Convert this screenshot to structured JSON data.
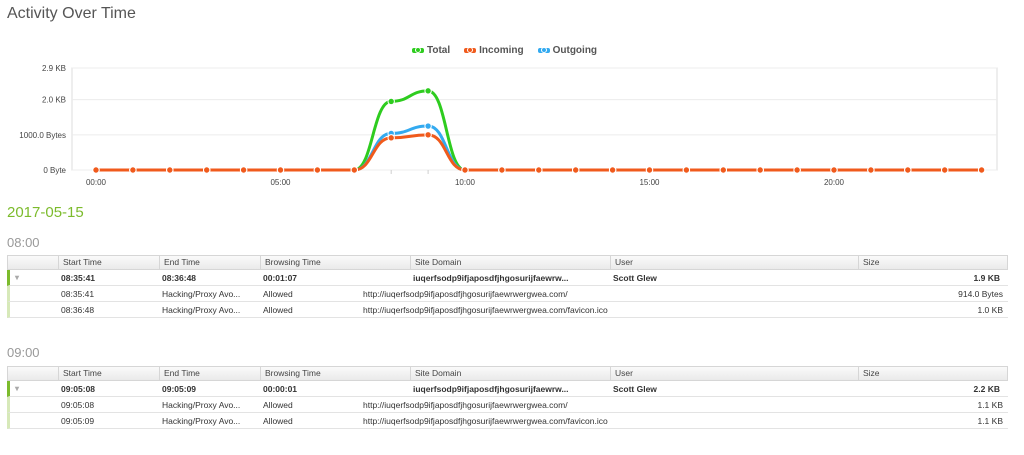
{
  "page": {
    "title": "Activity Over Time"
  },
  "chart_data": {
    "type": "line",
    "title": "",
    "x": [
      0,
      1,
      2,
      3,
      4,
      5,
      6,
      7,
      8,
      9,
      10,
      11,
      12,
      13,
      14,
      15,
      16,
      17,
      18,
      19,
      20,
      21,
      22,
      23,
      24
    ],
    "xticks": [
      "00:00",
      "05:00",
      "10:00",
      "15:00",
      "20:00"
    ],
    "xtick_values": [
      0,
      5,
      10,
      15,
      20
    ],
    "yticks": [
      "0 Byte",
      "1000.0 Bytes",
      "2.0 KB",
      "2.9 KB"
    ],
    "ytick_values": [
      0,
      1000,
      2000,
      2900
    ],
    "ylim": [
      0,
      2900
    ],
    "legend_position": "top-center",
    "grid": true,
    "series": [
      {
        "name": "Total",
        "color": "#2ecc1f",
        "values": [
          0,
          0,
          0,
          0,
          0,
          0,
          0,
          0,
          1950,
          2250,
          0,
          0,
          0,
          0,
          0,
          0,
          0,
          0,
          0,
          0,
          0,
          0,
          0,
          0,
          0
        ]
      },
      {
        "name": "Incoming",
        "color": "#f05a1c",
        "values": [
          0,
          0,
          0,
          0,
          0,
          0,
          0,
          0,
          914,
          1000,
          0,
          0,
          0,
          0,
          0,
          0,
          0,
          0,
          0,
          0,
          0,
          0,
          0,
          0,
          0
        ]
      },
      {
        "name": "Outgoing",
        "color": "#33aaf0",
        "values": [
          0,
          0,
          0,
          0,
          0,
          0,
          0,
          0,
          1040,
          1250,
          0,
          0,
          0,
          0,
          0,
          0,
          0,
          0,
          0,
          0,
          0,
          0,
          0,
          0,
          0
        ]
      }
    ]
  },
  "date_heading": "2017-05-15",
  "columns": [
    "",
    "Start Time",
    "End Time",
    "Browsing Time",
    "Site Domain",
    "User",
    "Size"
  ],
  "groups": [
    {
      "hour": "08:00",
      "main": {
        "caret": "▾",
        "start": "08:35:41",
        "end": "08:36:48",
        "browsing": "00:01:07",
        "domain": "iuqerfsodp9ifjaposdfjhgosurijfaewrw...",
        "user": "Scott Glew",
        "size": "1.9 KB"
      },
      "subs": [
        {
          "time": "08:35:41",
          "category": "Hacking/Proxy Avo...",
          "status": "Allowed",
          "url": "http://iuqerfsodp9ifjaposdfjhgosurijfaewrwergwea.com/",
          "size": "914.0 Bytes"
        },
        {
          "time": "08:36:48",
          "category": "Hacking/Proxy Avo...",
          "status": "Allowed",
          "url": "http://iuqerfsodp9ifjaposdfjhgosurijfaewrwergwea.com/favicon.ico",
          "size": "1.0 KB"
        }
      ]
    },
    {
      "hour": "09:00",
      "main": {
        "caret": "▾",
        "start": "09:05:08",
        "end": "09:05:09",
        "browsing": "00:00:01",
        "domain": "iuqerfsodp9ifjaposdfjhgosurijfaewrw...",
        "user": "Scott Glew",
        "size": "2.2 KB"
      },
      "subs": [
        {
          "time": "09:05:08",
          "category": "Hacking/Proxy Avo...",
          "status": "Allowed",
          "url": "http://iuqerfsodp9ifjaposdfjhgosurijfaewrwergwea.com/",
          "size": "1.1 KB"
        },
        {
          "time": "09:05:09",
          "category": "Hacking/Proxy Avo...",
          "status": "Allowed",
          "url": "http://iuqerfsodp9ifjaposdfjhgosurijfaewrwergwea.com/favicon.ico",
          "size": "1.1 KB"
        }
      ]
    }
  ]
}
